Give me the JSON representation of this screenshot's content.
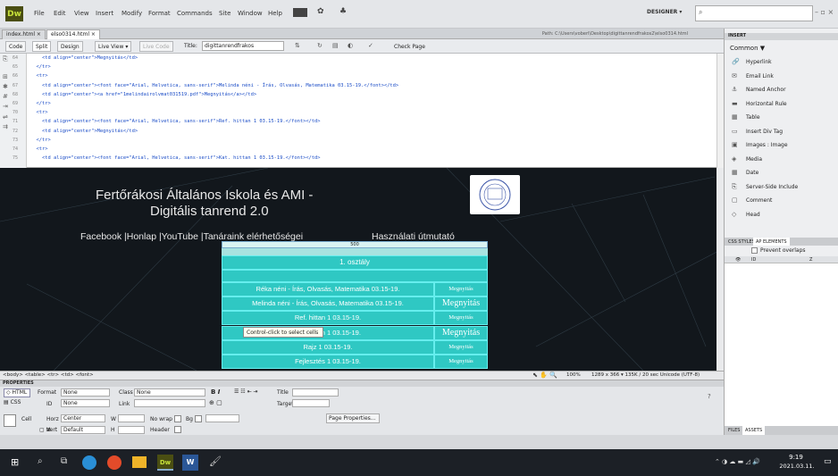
{
  "app": {
    "logo": "Dw",
    "menu": [
      "File",
      "Edit",
      "View",
      "Insert",
      "Modify",
      "Format",
      "Commands",
      "Site",
      "Window",
      "Help"
    ],
    "workspace": "DESIGNER ▾",
    "search_placeholder": "",
    "window_controls": "– ▫ ×"
  },
  "tabs": {
    "first": "index.html ×",
    "second": "elso0314.html ×",
    "path": "Path: C:\\Users\\voberi\\Desktop\\digittanrendfrakos2\\elso0314.html"
  },
  "toolbar": {
    "code": "Code",
    "split": "Split",
    "design": "Design",
    "liveview": "Live View",
    "livecode": "Live Code",
    "title_label": "Title:",
    "title_value": "digittanrendfrakos",
    "checkpage": "Check Page"
  },
  "code": {
    "lines": [
      {
        "no": "64",
        "text": "    <td align=\"center\">Megnyitás</td>"
      },
      {
        "no": "65",
        "text": "  </tr>"
      },
      {
        "no": "66",
        "text": "  <tr>"
      },
      {
        "no": "67",
        "text": "    <td align=\"center\"><font face=\"Arial, Helvetica, sans-serif\">Melinda néni - Írás, Olvasás, Matematika 03.15-19.</font></td>"
      },
      {
        "no": "68",
        "text": "    <td align=\"center\"><a href=\"1melindairolvmat031519.pdf\">Megnyitás</a></td>"
      },
      {
        "no": "69",
        "text": "  </tr>"
      },
      {
        "no": "70",
        "text": "  <tr>"
      },
      {
        "no": "71",
        "text": "    <td align=\"center\"><font face=\"Arial, Helvetica, sans-serif\">Ref. hittan 1 03.15-19.</font></td>"
      },
      {
        "no": "72",
        "text": "    <td align=\"center\">Megnyitás</td>"
      },
      {
        "no": "73",
        "text": "  </tr>"
      },
      {
        "no": "74",
        "text": "  <tr>"
      },
      {
        "no": "75",
        "text": "    <td align=\"center\"><font face=\"Arial, Helvetica, sans-serif\">Kat. hittan 1 03.15-19.</font></td>"
      }
    ]
  },
  "design": {
    "school_title": "Fertőrákosi Általános Iskola és AMI -",
    "subtitle": "Digitális tanrend 2.0",
    "nav": "Facebook |Honlap |YouTube |Tanáraink elérhetőségei",
    "nav_link": "Használati útmutató",
    "table_header": "1. osztály",
    "tooltip": "Control-click to select cells",
    "width_marker": "500",
    "rows": [
      {
        "subject": "Réka néni - Írás, Olvasás, Matematika 03.15-19.",
        "action": "Megnyitás",
        "big": false
      },
      {
        "subject": "Melinda néni - Írás, Olvasás, Matematika 03.15-19.",
        "action": "Megnyitás",
        "big": true
      },
      {
        "subject": "Ref. hittan 1 03.15-19.",
        "action": "Megnyitás",
        "big": false
      },
      {
        "subject": "Kat. hittan 1 03.15-19.",
        "action": "Megnyitás",
        "big": true
      },
      {
        "subject": "Rajz 1 03.15-19.",
        "action": "Megnyitás",
        "big": false
      },
      {
        "subject": "Fejlesztés 1 03.15-19.",
        "action": "Megnyitás",
        "big": false
      }
    ]
  },
  "statusbar": {
    "breadcrumb": "<body> <table> <tr> <td> <font>",
    "zoom": "100%",
    "info": "1289 x 366 ▾  135K / 20 sec  Unicode (UTF-8)"
  },
  "properties": {
    "header": "PROPERTIES",
    "html": "HTML",
    "css": "CSS",
    "format_label": "Format",
    "format_value": "None",
    "class_label": "Class",
    "class_value": "None",
    "id_label": "ID",
    "id_value": "None",
    "link_label": "Link",
    "title_label": "Title",
    "target_label": "Target",
    "cell_label": "Cell",
    "horz_label": "Horz",
    "horz_value": "Center",
    "vert_label": "Vert",
    "vert_value": "Default",
    "w_label": "W",
    "h_label": "H",
    "nowrap_label": "No wrap",
    "bg_label": "Bg",
    "header_label": "Header",
    "page_props": "Page Properties..."
  },
  "rpanel": {
    "insert": "INSERT",
    "common": "Common ▼",
    "items": [
      "Hyperlink",
      "Email Link",
      "Named Anchor",
      "Horizontal Rule",
      "Table",
      "Insert Div Tag",
      "Images : Image",
      "Media",
      "Date",
      "Server-Side Include",
      "Comment",
      "Head"
    ],
    "css_styles": "CSS STYLES",
    "ap_elements": "AP ELEMENTS",
    "prevent": "Prevent overlaps",
    "col_id": "ID",
    "col_z": "Z",
    "files": "FILES",
    "assets": "ASSETS"
  },
  "taskbar": {
    "time": "9:19",
    "date": "2021.03.11."
  },
  "colors": {
    "teal": "#2fc8c3",
    "dark": "#12171c",
    "accent": "#1e88e5"
  }
}
